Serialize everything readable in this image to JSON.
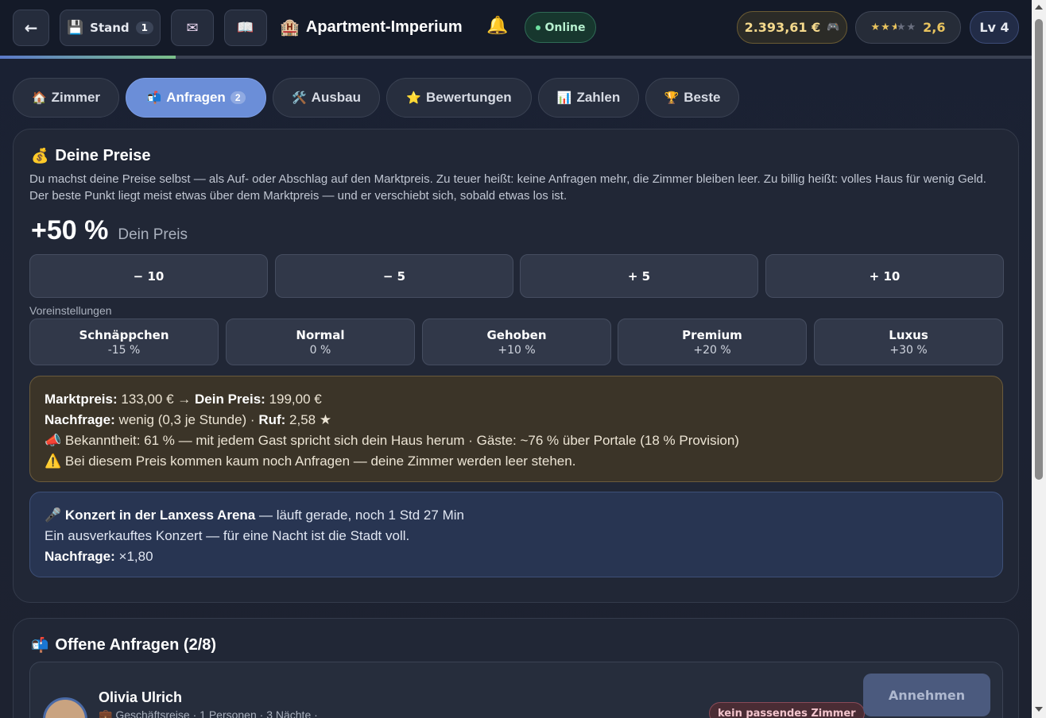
{
  "topbar": {
    "back_label": "←",
    "save_label": "Stand",
    "save_count": "1",
    "mail_icon": "✉",
    "book_icon": "📖",
    "title_icon": "🏨",
    "title": "Apartment-Imperium",
    "bell_icon": "🔔",
    "online_label": "Online",
    "money": "2.393,61 €",
    "money_icon": "🎮",
    "rating_value": "2,6",
    "rating_stars": 2.5,
    "level": "Lv 4",
    "progress": 0.17
  },
  "tabs": [
    {
      "icon": "🏠",
      "label": "Zimmer"
    },
    {
      "icon": "📬",
      "label": "Anfragen",
      "badge": "2"
    },
    {
      "icon": "🛠️",
      "label": "Ausbau"
    },
    {
      "icon": "⭐",
      "label": "Bewertungen"
    },
    {
      "icon": "📊",
      "label": "Zahlen"
    },
    {
      "icon": "🏆",
      "label": "Beste"
    }
  ],
  "pricing": {
    "icon": "💰",
    "title": "Deine Preise",
    "description": "Du machst deine Preise selbst — als Auf- oder Abschlag auf den Marktpreis. Zu teuer heißt: keine Anfragen mehr, die Zimmer bleiben leer. Zu billig heißt: volles Haus für wenig Geld. Der beste Punkt liegt meist etwas über dem Marktpreis — und er verschiebt sich, sobald etwas los ist.",
    "current_value": "+50 %",
    "current_label": "Dein Preis",
    "steps": [
      "− 10",
      "− 5",
      "+ 5",
      "+ 10"
    ],
    "presets_label": "Voreinstellungen",
    "presets": [
      {
        "name": "Schnäppchen",
        "pct": "-15 %"
      },
      {
        "name": "Normal",
        "pct": "0 %"
      },
      {
        "name": "Gehoben",
        "pct": "+10 %"
      },
      {
        "name": "Premium",
        "pct": "+20 %"
      },
      {
        "name": "Luxus",
        "pct": "+30 %"
      }
    ],
    "info": {
      "market_label": "Marktpreis:",
      "market_value": "133,00 € →",
      "your_label": "Dein Preis:",
      "your_value": "199,00 €",
      "demand_label": "Nachfrage:",
      "demand_value": "wenig (0,3 je Stunde) ·",
      "rep_label": "Ruf:",
      "rep_value": "2,58 ★",
      "awareness_icon": "📣",
      "awareness": "Bekanntheit: 61 % — mit jedem Gast spricht sich dein Haus herum · Gäste: ~76 % über Portale (18 % Provision)",
      "warning_icon": "⚠️",
      "warning": "Bei diesem Preis kommen kaum noch Anfragen — deine Zimmer werden leer stehen."
    },
    "event": {
      "icon": "🎤",
      "title": "Konzert in der Lanxess Arena",
      "status": "— läuft gerade, noch 1 Std 27 Min",
      "description": "Ein ausverkauftes Konzert — für eine Nacht ist die Stadt voll.",
      "demand_label": "Nachfrage:",
      "demand_value": "×1,80"
    }
  },
  "requests": {
    "icon": "📬",
    "title": "Offene Anfragen (2/8)",
    "items": [
      {
        "name": "Olivia Ulrich",
        "sub_icon": "💼",
        "sub": "Geschäftsreise · 1 Personen · 3 Nächte ·",
        "badge": "kein passendes Zimmer",
        "accept_label": "Annehmen"
      }
    ]
  },
  "colors": {
    "accent": "#6b8ed8",
    "gold": "#f4d98c",
    "warning_bg": "#3b3428",
    "event_bg": "#283552"
  }
}
